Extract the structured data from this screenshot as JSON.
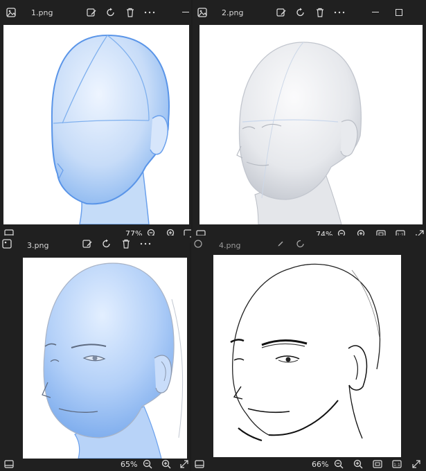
{
  "windows": [
    {
      "id": "w1",
      "filename": "1.png",
      "zoom": "77%"
    },
    {
      "id": "w2",
      "filename": "2.png",
      "zoom": "74%"
    },
    {
      "id": "w3",
      "filename": "3.png",
      "zoom": "65%"
    },
    {
      "id": "w4",
      "filename": "4.png",
      "zoom": "66%"
    }
  ],
  "colors": {
    "window_bg": "#202020",
    "canvas_bg": "#ffffff",
    "mannequin_blue": "#a9cdf7",
    "outline_blue": "#5a95e8"
  },
  "icons": {
    "app": "photo-icon",
    "edit": "edit-image-icon",
    "rotate": "rotate-icon",
    "delete": "trash-icon",
    "more": "more-icon",
    "minimize": "minimize-icon",
    "maximize": "maximize-icon",
    "filmstrip": "filmstrip-icon",
    "zoom_out": "zoom-out-icon",
    "zoom_in": "zoom-in-icon",
    "fit": "fit-to-window-icon",
    "actual_size": "actual-size-icon",
    "fullscreen": "fullscreen-icon"
  }
}
